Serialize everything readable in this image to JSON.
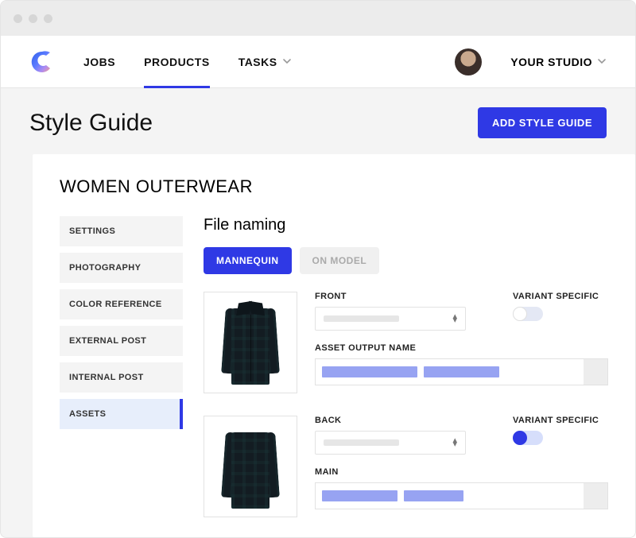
{
  "nav": {
    "jobs": "JOBS",
    "products": "PRODUCTS",
    "tasks": "TASKS",
    "studio": "YOUR STUDIO"
  },
  "page": {
    "title": "Style Guide",
    "add_button": "ADD STYLE GUIDE"
  },
  "card": {
    "title": "WOMEN OUTERWEAR"
  },
  "sidebar": {
    "items": [
      {
        "label": "SETTINGS"
      },
      {
        "label": "PHOTOGRAPHY"
      },
      {
        "label": "COLOR REFERENCE"
      },
      {
        "label": "EXTERNAL POST"
      },
      {
        "label": "INTERNAL POST"
      },
      {
        "label": "ASSETS"
      }
    ],
    "active_index": 5
  },
  "content": {
    "section_title": "File naming",
    "tabs": {
      "mannequin": "MANNEQUIN",
      "on_model": "ON MODEL",
      "active": "mannequin"
    },
    "rows": [
      {
        "position_label": "FRONT",
        "variant_label": "VARIANT SPECIFIC",
        "variant_on": false,
        "output_label": "ASSET OUTPUT NAME"
      },
      {
        "position_label": "BACK",
        "variant_label": "VARIANT SPECIFIC",
        "variant_on": true,
        "output_label": "MAIN"
      }
    ]
  }
}
